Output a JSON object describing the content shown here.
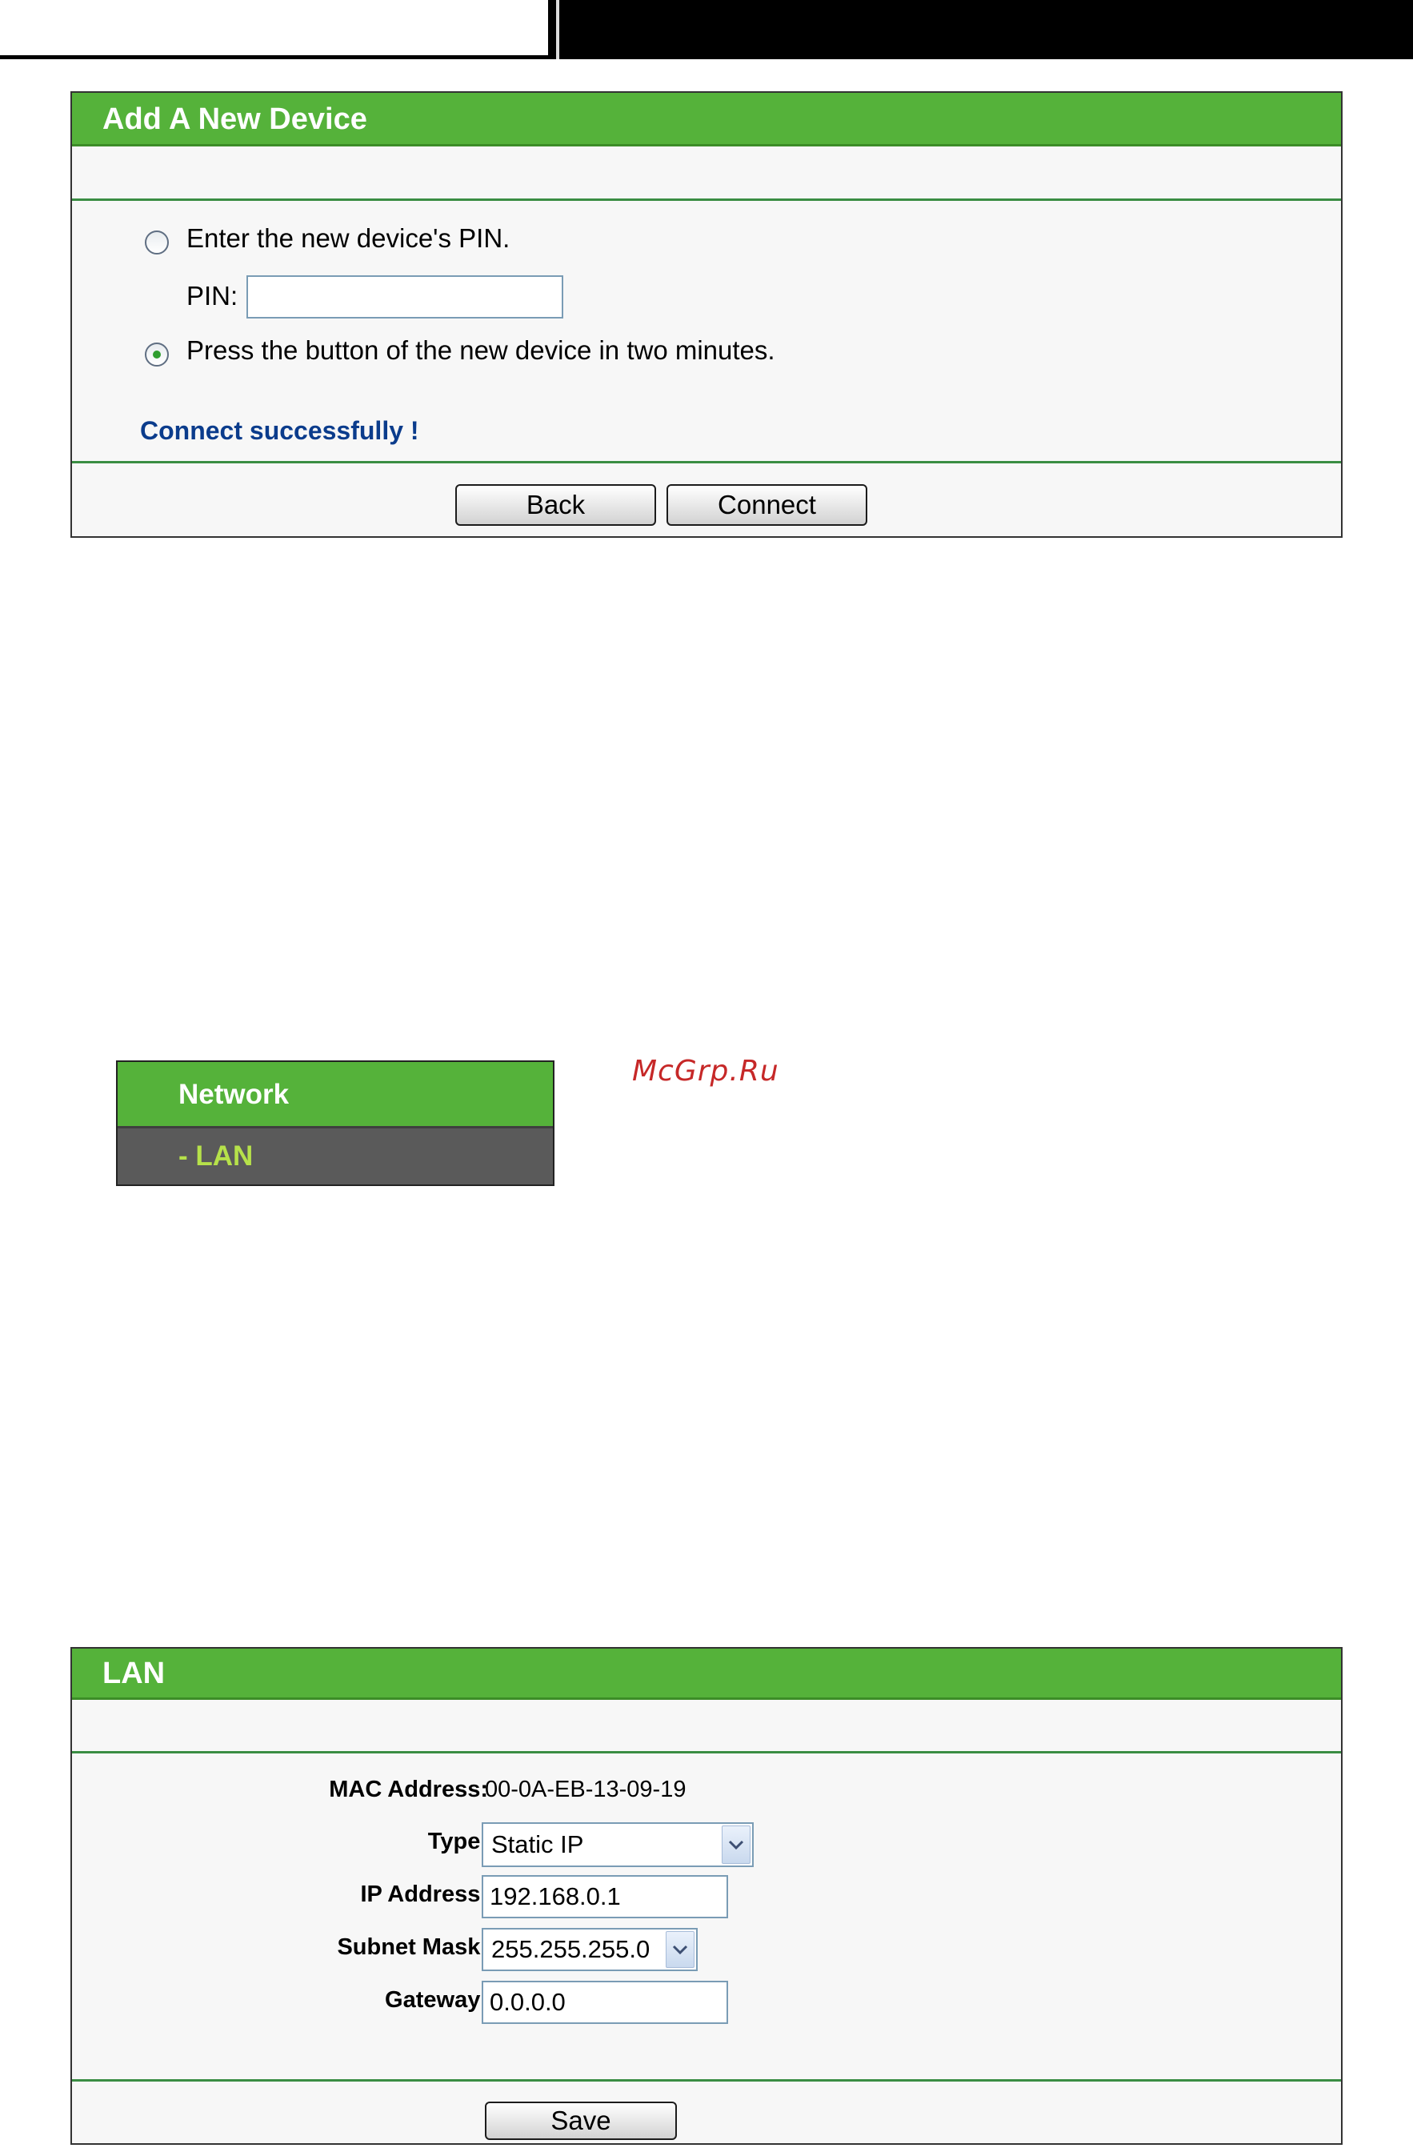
{
  "wps_panel": {
    "title": "Add A New Device",
    "option_pin_label": "Enter the new device's PIN.",
    "pin_label": "PIN:",
    "pin_value": "",
    "option_button_label": "Press the button of the new device in two minutes.",
    "selected_option": "button",
    "status_message": "Connect successfully !",
    "back_label": "Back",
    "connect_label": "Connect"
  },
  "menu": {
    "section": "Network",
    "item": "- LAN"
  },
  "watermark": "McGrp.Ru",
  "lan_panel": {
    "title": "LAN",
    "mac_label": "MAC Address:",
    "mac_value": "00-0A-EB-13-09-19",
    "type_label": "Type:",
    "type_value": "Static IP",
    "ip_label": "IP Address:",
    "ip_value": "192.168.0.1",
    "mask_label": "Subnet Mask:",
    "mask_value": "255.255.255.0",
    "gateway_label": "Gateway:",
    "gateway_value": "0.0.0.0",
    "save_label": "Save"
  },
  "colors": {
    "title_green": "#55b23a",
    "rule_green": "#3a8d43",
    "status_blue": "#0b3c8c",
    "menu_dark": "#5a5a5a",
    "menu_item_text": "#b6e14a",
    "watermark_red": "#c62828"
  },
  "icons": [
    "radio-unchecked-icon",
    "radio-checked-icon",
    "chevron-down-icon"
  ]
}
